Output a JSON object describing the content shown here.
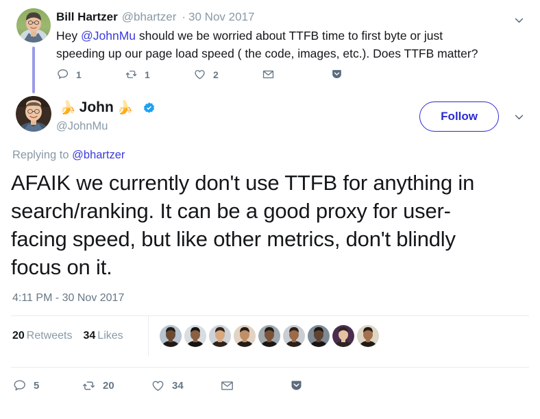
{
  "parent_tweet": {
    "avatar_name": "bill-hartzer-avatar",
    "display_name": "Bill Hartzer",
    "handle": "@bhartzer",
    "separator": "·",
    "date": "30 Nov 2017",
    "text_part1": "Hey ",
    "mention": "@JohnMu",
    "text_part2": " should we be worried about TTFB time to first byte or just speeding up our page load speed ( the code, images, etc.). Does TTFB matter?",
    "actions": {
      "reply_count": "1",
      "retweet_count": "1",
      "like_count": "2",
      "message_label": "",
      "bookmark_label": ""
    }
  },
  "main_tweet": {
    "avatar_name": "john-mueller-avatar",
    "emoji_left": "🍌",
    "display_name": "John",
    "emoji_right": "🍌",
    "verified": true,
    "handle": "@JohnMu",
    "follow_label": "Follow",
    "replying_prefix": "Replying to ",
    "replying_mention": "@bhartzer",
    "text": "AFAIK we currently don't use TTFB for anything in search/ranking. It can be a good proxy for user-facing speed, but like other metrics, don't blindly focus on it.",
    "timestamp": "4:11 PM - 30 Nov 2017",
    "stats": {
      "retweets_count": "20",
      "retweets_label": "Retweets",
      "likes_count": "34",
      "likes_label": "Likes"
    },
    "facepile_count": 9,
    "actions": {
      "reply_count": "5",
      "retweet_count": "20",
      "like_count": "34",
      "message_label": "",
      "bookmark_label": ""
    }
  },
  "colors": {
    "link": "#3b3bdb",
    "follow_accent": "#2b2bd4",
    "muted": "#8899a6",
    "icon": "#667786",
    "verified_blue": "#1da1f2",
    "thread_line": "#9a9ae8",
    "divider": "#e6ecf0",
    "text": "#14171a"
  },
  "icons": {
    "chevron_down": "chevron-down-icon",
    "reply": "reply-icon",
    "retweet": "retweet-icon",
    "like": "heart-icon",
    "message": "envelope-icon",
    "bookmark": "bookmark-icon"
  }
}
